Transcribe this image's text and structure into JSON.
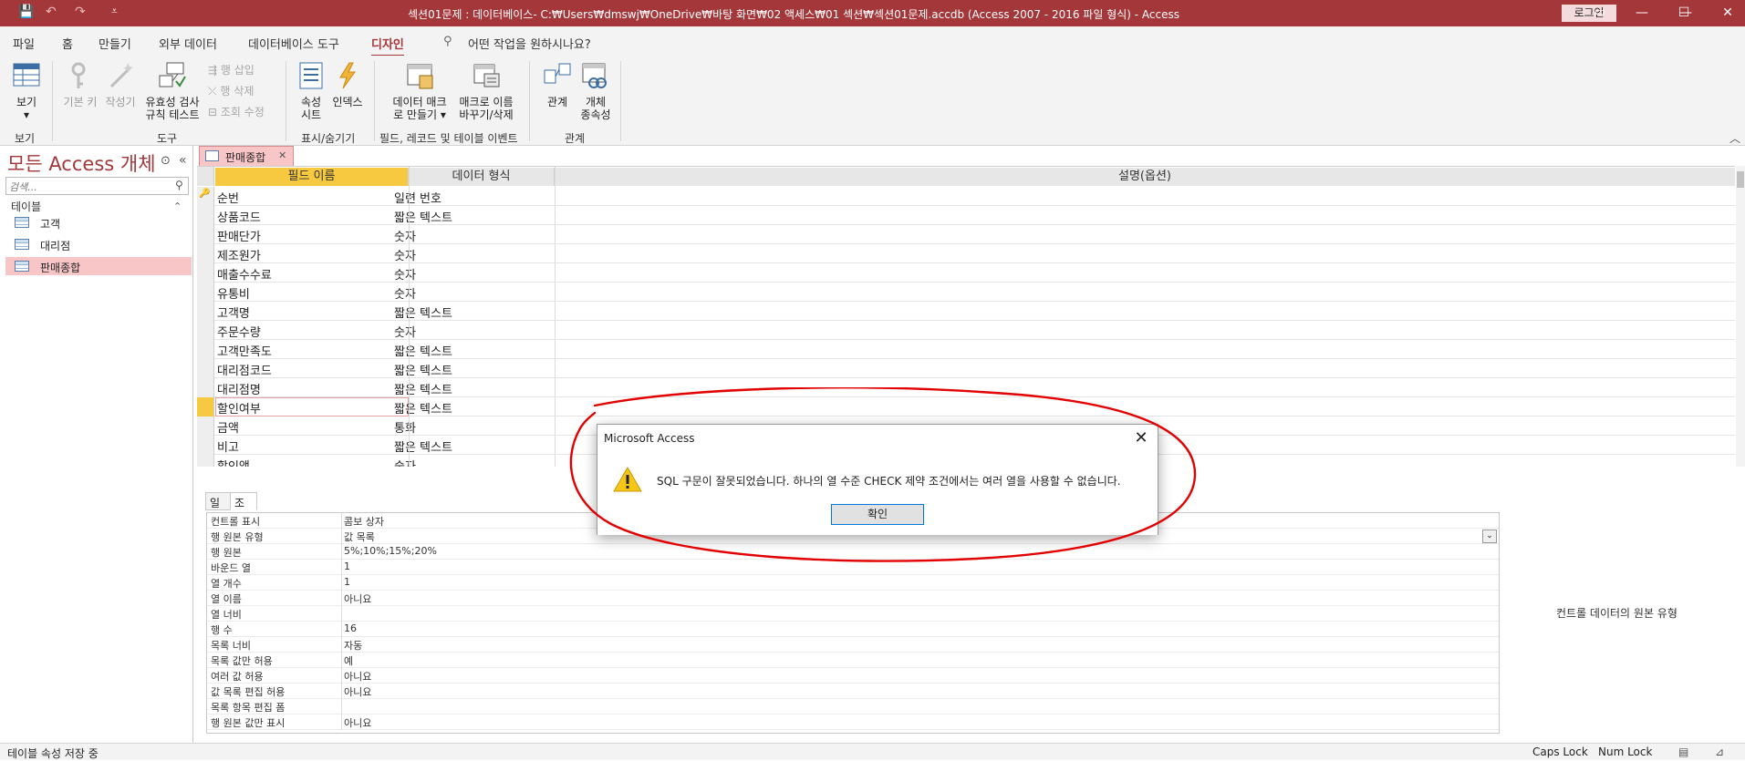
{
  "titlebar": {
    "title": "섹션01문제 : 데이터베이스- C:₩Users₩dmswj₩OneDrive₩바탕 화면₩02 액세스₩01 섹션₩섹션01문제.accdb (Access 2007 - 2016 파일 형식)  -  Access",
    "login": "로그인",
    "qa_save": "💾",
    "qa_undo": "↶",
    "qa_redo": "↷",
    "qa_more": "⩡",
    "minimize": "—",
    "restore": "☐",
    "close": "✕",
    "ribbon_opt": "▭"
  },
  "menu": {
    "file": "파일",
    "home": "홈",
    "create": "만들기",
    "external": "외부 데이터",
    "dbtools": "데이터베이스 도구",
    "design": "디자인",
    "tellme": "어떤 작업을 원하시나요?"
  },
  "ribbon": {
    "view": "보기",
    "view_arrow": "▾",
    "views_group": "보기",
    "primary_key": "기본 키",
    "builder": "작성기",
    "validation_line1": "유효성 검사",
    "validation_line2": "규칙 테스트",
    "insert_rows": "행 삽입",
    "delete_rows": "행 삭제",
    "modify_lookups": "조회 수정",
    "tools_group": "도구",
    "property_line1": "속성",
    "property_line2": "시트",
    "indexes": "인덱스",
    "showhide_group": "표시/숨기기",
    "datamacro_line1": "데이터 매크",
    "datamacro_line2": "로 만들기 ▾",
    "renamemacro_line1": "매크로 이름",
    "renamemacro_line2": "바꾸기/삭제",
    "events_group": "필드, 레코드 및 테이블 이벤트",
    "relationships": "관계",
    "dependencies_line1": "개체",
    "dependencies_line2": "종속성",
    "rel_group": "관계",
    "collapse": "︿"
  },
  "nav": {
    "title": "모든 Access 개체",
    "title_btn": "⊙",
    "collapse_btn": "«",
    "search_placeholder": "검색...",
    "section": "테이블",
    "section_toggle": "⌃",
    "items": [
      "고객",
      "대리점",
      "판매종합"
    ]
  },
  "doctab": {
    "label": "판매종합",
    "close": "✕"
  },
  "grid": {
    "headers": [
      "필드 이름",
      "데이터 형식",
      "설명(옵션)"
    ],
    "rows": [
      {
        "field": "순번",
        "type": "일련 번호"
      },
      {
        "field": "상품코드",
        "type": "짧은 텍스트"
      },
      {
        "field": "판매단가",
        "type": "숫자"
      },
      {
        "field": "제조원가",
        "type": "숫자"
      },
      {
        "field": "매출수수료",
        "type": "숫자"
      },
      {
        "field": "유통비",
        "type": "숫자"
      },
      {
        "field": "고객명",
        "type": "짧은 텍스트"
      },
      {
        "field": "주문수량",
        "type": "숫자"
      },
      {
        "field": "고객만족도",
        "type": "짧은 텍스트"
      },
      {
        "field": "대리점코드",
        "type": "짧은 텍스트"
      },
      {
        "field": "대리점명",
        "type": "짧은 텍스트"
      },
      {
        "field": "할인여부",
        "type": "짧은 텍스트"
      },
      {
        "field": "금액",
        "type": "통화"
      },
      {
        "field": "비고",
        "type": "짧은 텍스트"
      },
      {
        "field": "할인액",
        "type": "숫자"
      }
    ],
    "key_marker": "🔑"
  },
  "prop_tabs": [
    "일반",
    "조회"
  ],
  "props": [
    {
      "name": "컨트롤 표시",
      "value": "콤보 상자"
    },
    {
      "name": "행 원본 유형",
      "value": "값 목록"
    },
    {
      "name": "행 원본",
      "value": "5%;10%;15%;20%"
    },
    {
      "name": "바운드 열",
      "value": "1"
    },
    {
      "name": "열 개수",
      "value": "1"
    },
    {
      "name": "열 이름",
      "value": "아니요"
    },
    {
      "name": "열 너비",
      "value": ""
    },
    {
      "name": "행 수",
      "value": "16"
    },
    {
      "name": "목록 너비",
      "value": "자동"
    },
    {
      "name": "목록 값만 허용",
      "value": "예"
    },
    {
      "name": "여러 값 허용",
      "value": "아니요"
    },
    {
      "name": "값 목록 편집 허용",
      "value": "아니요"
    },
    {
      "name": "목록 항목 편집 폼",
      "value": ""
    },
    {
      "name": "행 원본 값만 표시",
      "value": "아니요"
    }
  ],
  "help_text": "컨트롤 데이터의 원본 유형",
  "status": {
    "left": "테이블 속성 저장 중",
    "caps": "Caps Lock",
    "num": "Num Lock"
  },
  "dialog": {
    "title": "Microsoft Access",
    "message": "SQL 구문이 잘못되었습니다. 하나의 열 수준 CHECK 제약 조건에서는 여러 열을 사용할 수 없습니다.",
    "ok": "확인",
    "close": "✕"
  },
  "colors": {
    "accent": "#a4373a",
    "selected_nav": "#f9c6c8",
    "active_header": "#f7c940",
    "annotation": "#e30000"
  }
}
